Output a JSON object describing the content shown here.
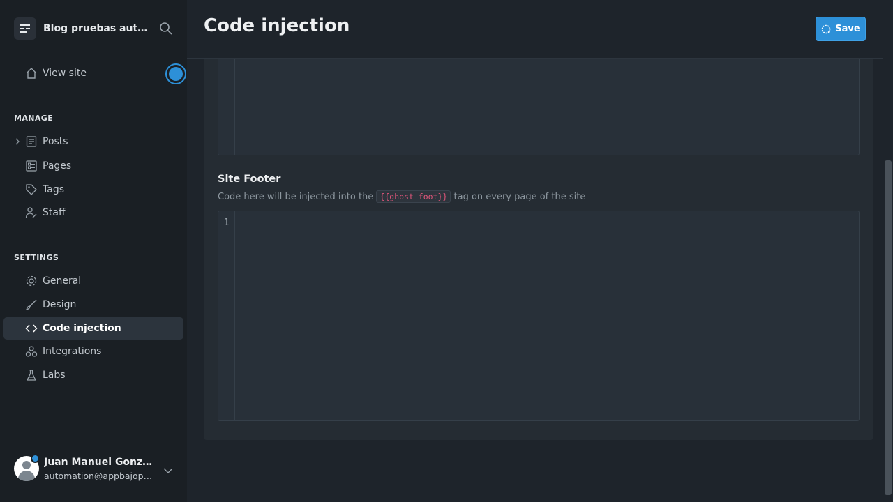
{
  "app": {
    "site_title": "Blog pruebas auto...",
    "page_title": "Code injection",
    "save_label": "Save"
  },
  "sidebar": {
    "view_site": "View site",
    "manage_heading": "MANAGE",
    "manage_items": [
      {
        "label": "Posts",
        "icon": "posts-icon"
      },
      {
        "label": "Pages",
        "icon": "pages-icon"
      },
      {
        "label": "Tags",
        "icon": "tag-icon"
      },
      {
        "label": "Staff",
        "icon": "staff-icon"
      }
    ],
    "settings_heading": "SETTINGS",
    "settings_items": [
      {
        "label": "General",
        "icon": "gear-icon"
      },
      {
        "label": "Design",
        "icon": "brush-icon"
      },
      {
        "label": "Code injection",
        "icon": "code-icon",
        "active": true
      },
      {
        "label": "Integrations",
        "icon": "integrations-icon"
      },
      {
        "label": "Labs",
        "icon": "flask-icon"
      }
    ]
  },
  "user": {
    "name": "Juan Manuel Gonzále...",
    "email": "automation@appbajopru..."
  },
  "site_footer": {
    "title": "Site Footer",
    "desc_before": "Code here will be injected into the",
    "code_tag": "{{ghost_foot}}",
    "desc_after": "tag on every page of the site",
    "line_number": "1"
  },
  "colors": {
    "accent": "#2d90d8",
    "sidebar_bg": "#1a1f24",
    "main_bg": "#1e242b",
    "code_tag": "#e2567b"
  }
}
